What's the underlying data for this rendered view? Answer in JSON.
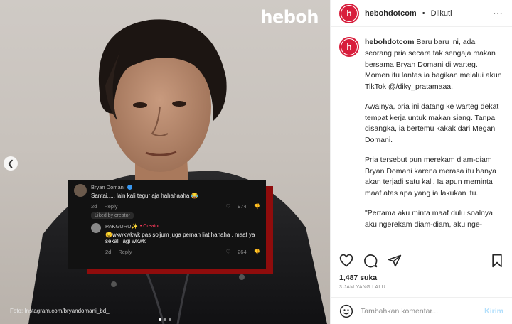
{
  "media": {
    "watermark": "heboh",
    "photo_credit": "Foto: Instagram.com/bryandomani_bd_",
    "overlay": {
      "comment1": {
        "user": "Bryan Domani",
        "text": "Santai..... lain kali tegur aja hahahaaha 😂",
        "time": "2d",
        "reply_label": "Reply",
        "likes": "974",
        "liked_by": "Liked by creator"
      },
      "comment2": {
        "user": "PAKGURU✨",
        "badge": "• Creator",
        "text": "😉wkwkwkwk pas soljum juga pernah liat hahaha . maaf ya sekali lagi wkwk",
        "time": "2d",
        "reply_label": "Reply",
        "likes": "264"
      }
    }
  },
  "header": {
    "username": "hebohdotcom",
    "separator": "•",
    "follow_status": "Diikuti",
    "avatar_letter": "h"
  },
  "caption": {
    "username": "hebohdotcom",
    "p1": " Baru baru ini, ada seorang pria secara tak sengaja makan bersama Bryan Domani di warteg. Momen itu lantas ia bagikan melalui akun TikTok @/diky_pratamaaa.",
    "p2": "Awalnya, pria ini datang ke warteg dekat tempat kerja untuk makan siang. Tanpa disangka, ia bertemu kakak dari Megan Domani.",
    "p3": "Pria tersebut pun merekam diam-diam Bryan Domani karena merasa itu hanya akan terjadi satu kali. Ia apun meminta maaf atas apa yang ia lakukan itu.",
    "p4": "\"Pertama aku minta maaf dulu soalnya aku ngerekam diam-diam, aku nge-"
  },
  "stats": {
    "likes": "1,487 suka",
    "timestamp": "3 JAM YANG LALU"
  },
  "comment_box": {
    "placeholder": "Tambahkan komentar...",
    "send_label": "Kirim"
  },
  "colors": {
    "brand": "#d81e3c",
    "overlay_card": "#121212",
    "overlay_accent": "#8f0c0c",
    "link_disabled": "#b2dffc"
  }
}
